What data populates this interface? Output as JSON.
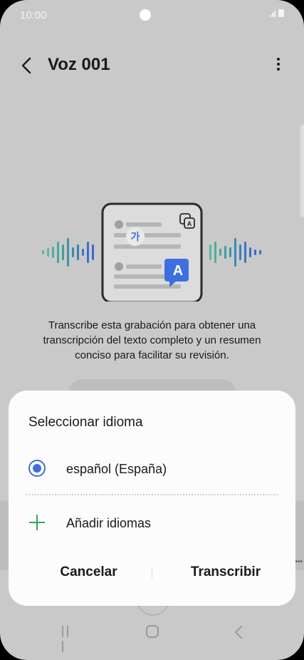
{
  "status_bar": {
    "time": "10:00"
  },
  "header": {
    "title": "Voz 001"
  },
  "illustration": {
    "source_char": "가",
    "target_char": "A"
  },
  "description": "Transcribe esta grabación para obtener una transcripción del texto completo y un resumen conciso para facilitar su revisión.",
  "dialog": {
    "title": "Seleccionar idioma",
    "selected_language": "español (España)",
    "add_languages": "Añadir idiomas",
    "cancel_label": "Cancelar",
    "transcribe_label": "Transcribir"
  },
  "colors": {
    "accent": "#3d6fe0",
    "plus": "#37a35c",
    "dialog_bg": "#fcfcfc"
  }
}
